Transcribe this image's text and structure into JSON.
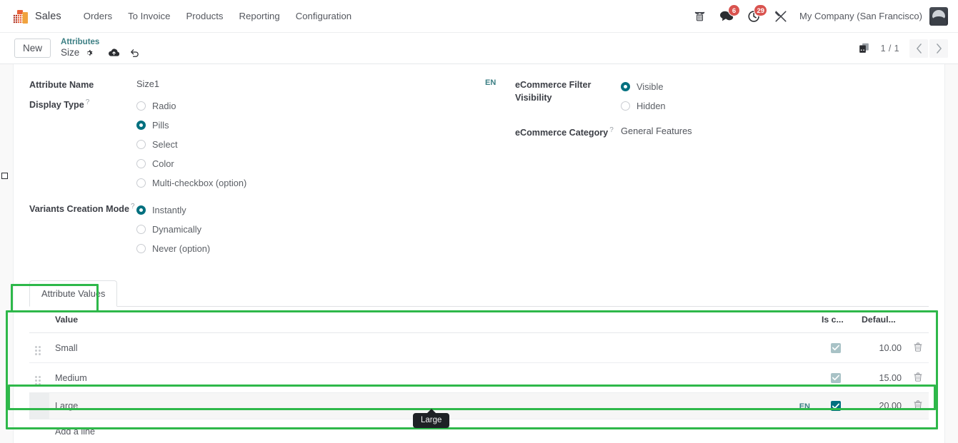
{
  "navbar": {
    "app_icon": "sales-app-icon",
    "app_name": "Sales",
    "menu": [
      {
        "label": "Orders"
      },
      {
        "label": "To Invoice"
      },
      {
        "label": "Products"
      },
      {
        "label": "Reporting"
      },
      {
        "label": "Configuration"
      }
    ],
    "tray": {
      "voip_icon": "phone-icon",
      "messages_icon": "chat-bubble-icon",
      "messages_count": "6",
      "activities_icon": "clock-icon",
      "activities_count": "29",
      "apps_icon": "wrench-icon",
      "company": "My Company (San Francisco)",
      "avatar": "user-avatar"
    }
  },
  "control_panel": {
    "new_label": "New",
    "breadcrumb_parent": "Attributes",
    "breadcrumb_current": "Size",
    "gear_icon": "gear-icon",
    "save_icon": "cloud-save-icon",
    "discard_icon": "undo-discard-icon",
    "smart_button_icon": "product-variants-icon",
    "pager": "1 / 1",
    "prev_icon": "chevron-left-icon",
    "next_icon": "chevron-right-icon"
  },
  "form": {
    "attribute_name": {
      "label": "Attribute Name",
      "value": "Size1"
    },
    "display_type": {
      "label": "Display Type",
      "help": "?",
      "selected": "Pills",
      "options": [
        {
          "label": "Radio",
          "checked": false
        },
        {
          "label": "Pills",
          "checked": true
        },
        {
          "label": "Select",
          "checked": false
        },
        {
          "label": "Color",
          "checked": false
        },
        {
          "label": "Multi-checkbox (option)",
          "checked": false
        }
      ]
    },
    "variants_creation_mode": {
      "label": "Variants Creation Mode",
      "help": "?",
      "selected": "Instantly",
      "options": [
        {
          "label": "Instantly",
          "checked": true
        },
        {
          "label": "Dynamically",
          "checked": false
        },
        {
          "label": "Never (option)",
          "checked": false
        }
      ]
    },
    "language_badge": "EN",
    "ecommerce_filter_visibility": {
      "label": "eCommerce Filter Visibility",
      "selected": "Visible",
      "options": [
        {
          "label": "Visible",
          "checked": true
        },
        {
          "label": "Hidden",
          "checked": false
        }
      ]
    },
    "ecommerce_category": {
      "label": "eCommerce Category",
      "help": "?",
      "value": "General Features"
    }
  },
  "notebook": {
    "tabs": [
      {
        "label": "Attribute Values",
        "active": true
      }
    ]
  },
  "values_table": {
    "columns": [
      {
        "key": "value",
        "label": "Value"
      },
      {
        "key": "is_custom",
        "label": "Is c..."
      },
      {
        "key": "default_extra_price",
        "label": "Defaul..."
      }
    ],
    "rows": [
      {
        "value": "Small",
        "lang": "",
        "is_custom": true,
        "is_custom_state": "muted",
        "default_extra_price": "10.00",
        "has_handle": true,
        "active": false
      },
      {
        "value": "Medium",
        "lang": "",
        "is_custom": true,
        "is_custom_state": "muted",
        "default_extra_price": "15.00",
        "has_handle": true,
        "active": false
      },
      {
        "value": "Large",
        "lang": "EN",
        "is_custom": true,
        "is_custom_state": "active",
        "default_extra_price": "20.00",
        "has_handle": false,
        "active": true
      }
    ],
    "add_line_label": "Add a line",
    "trash_icon": "trash-icon",
    "drag_handle_icon": "drag-handle-icon"
  },
  "tooltip": {
    "text": "Large"
  },
  "annotations": {
    "color": "#2eb84a",
    "boxes": [
      {
        "name": "attribute-values-tab-highlight"
      },
      {
        "name": "attribute-values-list-highlight"
      },
      {
        "name": "large-row-highlight"
      }
    ]
  }
}
